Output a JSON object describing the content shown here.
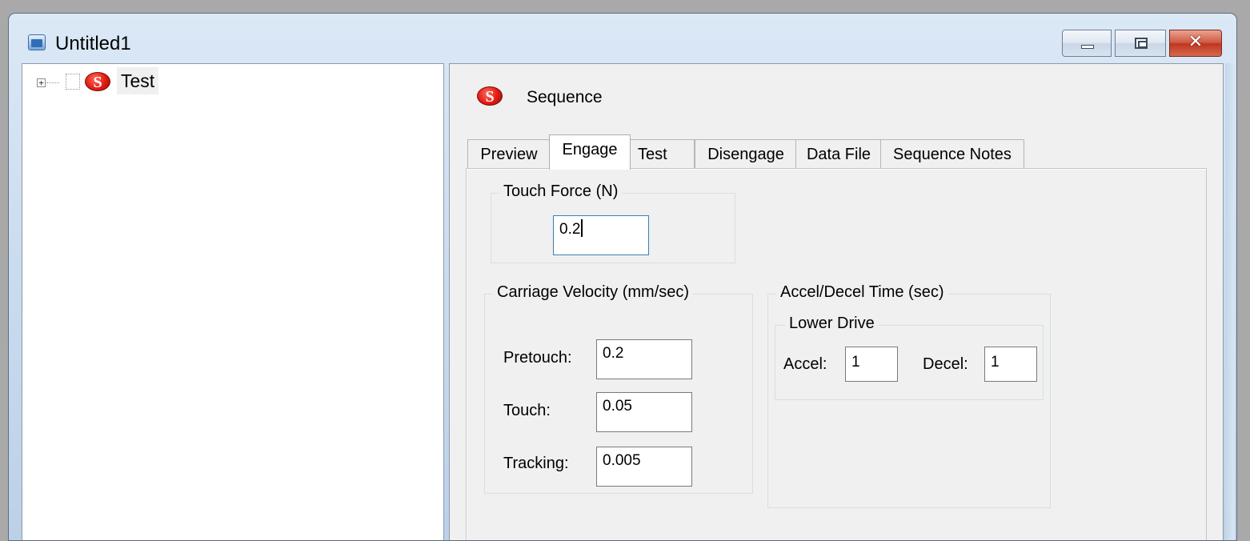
{
  "window": {
    "title": "Untitled1"
  },
  "tree": {
    "items": [
      {
        "expander": "+",
        "badge": "S",
        "label": "Test"
      }
    ]
  },
  "panel": {
    "badge": "S",
    "title": "Sequence",
    "tabs": [
      {
        "label": "Preview"
      },
      {
        "label": "Engage",
        "active": true
      },
      {
        "label": "Test"
      },
      {
        "label": "Disengage"
      },
      {
        "label": "Data File"
      },
      {
        "label": "Sequence Notes"
      }
    ]
  },
  "engage": {
    "touch_force": {
      "legend": "Touch Force (N)",
      "value": "0.2"
    },
    "carriage_velocity": {
      "legend": "Carriage Velocity (mm/sec)",
      "pretouch_label": "Pretouch:",
      "pretouch_value": "0.2",
      "touch_label": "Touch:",
      "touch_value": "0.05",
      "tracking_label": "Tracking:",
      "tracking_value": "0.005"
    },
    "accel_decel": {
      "legend": "Accel/Decel Time (sec)",
      "lower_drive_legend": "Lower Drive",
      "accel_label": "Accel:",
      "accel_value": "1",
      "decel_label": "Decel:",
      "decel_value": "1"
    }
  }
}
